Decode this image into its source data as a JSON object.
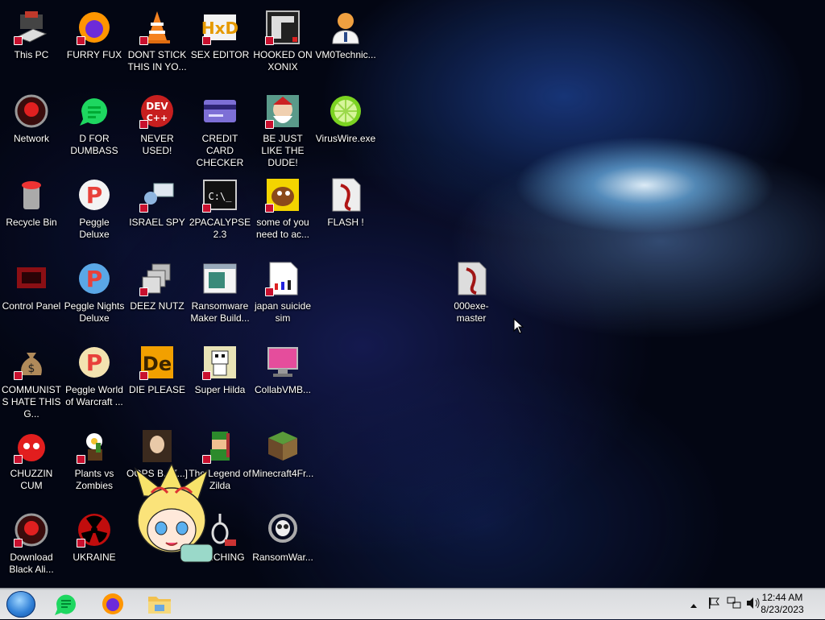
{
  "desktop": {
    "icons": [
      {
        "label": "This PC",
        "icon": "computer-icon"
      },
      {
        "label": "FURRY FUX",
        "icon": "firefox-icon"
      },
      {
        "label": "DONT STICK THIS IN YO...",
        "icon": "traffic-cone-icon"
      },
      {
        "label": "SEX EDITOR",
        "icon": "hxd-icon"
      },
      {
        "label": "HOOKED ON XONIX",
        "icon": "maze-icon"
      },
      {
        "label": "VM0Technic...",
        "icon": "user-person-icon"
      },
      {
        "label": "Network",
        "icon": "network-icon"
      },
      {
        "label": "D FOR DUMBASS",
        "icon": "chat-bubble-icon"
      },
      {
        "label": "NEVER USED!",
        "icon": "dev-cpp-icon"
      },
      {
        "label": "CREDIT CARD CHECKER",
        "icon": "credit-card-icon"
      },
      {
        "label": "BE JUST LIKE THE DUDE!",
        "icon": "dude-character-icon"
      },
      {
        "label": "VirusWire.exe",
        "icon": "lime-icon"
      },
      {
        "label": "Recycle Bin",
        "icon": "recycle-bin-icon"
      },
      {
        "label": "Peggle Deluxe",
        "icon": "peggle-icon"
      },
      {
        "label": "ISRAEL SPY",
        "icon": "network-spy-icon"
      },
      {
        "label": "2PACALYPSE 2.3",
        "icon": "terminal-icon"
      },
      {
        "label": "some of you need to ac...",
        "icon": "dog-icon"
      },
      {
        "label": "FLASH !",
        "icon": "flash-document-icon"
      },
      {
        "label": "Control Panel",
        "icon": "control-panel-icon"
      },
      {
        "label": "Peggle Nights Deluxe",
        "icon": "peggle-nights-icon"
      },
      {
        "label": "DEEZ NUTZ",
        "icon": "stacked-windows-icon"
      },
      {
        "label": "Ransomware Maker Build...",
        "icon": "window-app-icon"
      },
      {
        "label": "japan suicide sim",
        "icon": "document-icon"
      },
      {
        "label": "000exe-master",
        "icon": "file-icon"
      },
      {
        "label": "COMMUNISTS HATE THIS G...",
        "icon": "money-bag-icon"
      },
      {
        "label": "Peggle World of Warcraft ...",
        "icon": "peggle-wow-icon"
      },
      {
        "label": "DIE PLEASE",
        "icon": "de-icon"
      },
      {
        "label": "Super Hilda",
        "icon": "pixel-character-icon"
      },
      {
        "label": "CollabVMB...",
        "icon": "monitor-icon"
      },
      {
        "label": "CHUZZIN CUM",
        "icon": "chuzzle-icon"
      },
      {
        "label": "Plants vs Zombies",
        "icon": "plants-vs-zombies-icon"
      },
      {
        "label": "OOPS B... [...]",
        "icon": "portrait-icon"
      },
      {
        "label": "The Legend of Zilda",
        "icon": "legend-of-zilda-icon"
      },
      {
        "label": "Minecraft4Fr...",
        "icon": "minecraft-icon"
      },
      {
        "label": "Download Black Ali...",
        "icon": "network-icon"
      },
      {
        "label": "UKRAINE",
        "icon": "radiation-icon"
      },
      {
        "label": "LYNCHING",
        "icon": "noose-icon"
      },
      {
        "label": "RansomWar...",
        "icon": "skull-icon"
      }
    ]
  },
  "taskbar": {
    "start_label": "Start",
    "apps": [
      "chat-bubble-icon",
      "firefox-icon",
      "file-explorer-icon"
    ],
    "tray_icons": [
      "chevron-up-icon",
      "flag-icon",
      "network-icon",
      "speaker-icon"
    ],
    "time": "12:44 AM",
    "date": "8/23/2023"
  }
}
